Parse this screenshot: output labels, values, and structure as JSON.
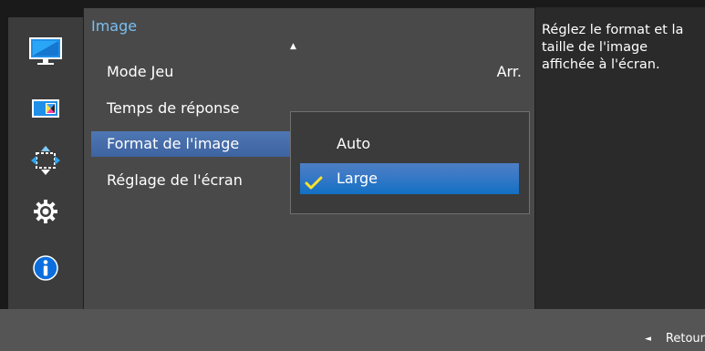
{
  "panel": {
    "title": "Image",
    "items": [
      {
        "label": "Mode Jeu",
        "value": "Arr."
      },
      {
        "label": "Temps de réponse",
        "value": ""
      },
      {
        "label": "Format de l'image",
        "value": ""
      },
      {
        "label": "Réglage de l'écran",
        "value": ""
      }
    ]
  },
  "dropdown": {
    "options": [
      {
        "label": "Auto",
        "selected": false
      },
      {
        "label": "Large",
        "selected": true
      }
    ]
  },
  "help": {
    "text": "Réglez le format et la taille de l'image affichée à l'écran."
  },
  "footer": {
    "back_label": "Retour"
  },
  "sidebar": {
    "icons": [
      "picture-icon",
      "color-icon",
      "size-position-icon",
      "settings-gear-icon",
      "info-icon"
    ],
    "active": "picture-icon"
  },
  "colors": {
    "title": "#79bff2",
    "selected_item": "#4e77b3",
    "selected_option": "#1170c4",
    "check": "#ffe22c",
    "info": "#0a6ede"
  }
}
